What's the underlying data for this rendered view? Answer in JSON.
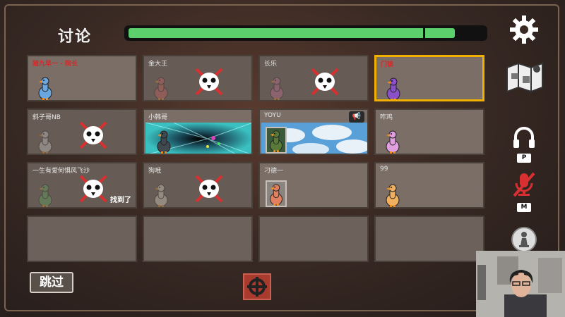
{
  "meeting": {
    "title": "讨论",
    "timer_progress": 0.92,
    "timer_marker": 0.83
  },
  "colors": {
    "timer": "#5bd06d",
    "selected": "#f0b000",
    "dead_cross": "#d83030",
    "accent_red": "#d42a2a"
  },
  "players": [
    {
      "name": "猪九早一 - 院长",
      "name_color": "red",
      "state": "alive",
      "goose_color": "#6aa6e0"
    },
    {
      "name": "金大王",
      "state": "dead",
      "goose_color": "#e06060"
    },
    {
      "name": "长乐",
      "state": "dead",
      "goose_color": "#d070a0"
    },
    {
      "name": "门锁",
      "name_color": "red",
      "state": "alive",
      "goose_color": "#8a50c8",
      "selected": true
    },
    {
      "name": "斜子哥NB",
      "state": "dead",
      "goose_color": "#d8d8d8"
    },
    {
      "name": "小韩哥",
      "state": "video",
      "goose_color": "#404850"
    },
    {
      "name": "YOYU",
      "state": "video2",
      "goose_color": "#5a7a3a"
    },
    {
      "name": "咋鸡",
      "state": "alive",
      "goose_color": "#e0a0e0"
    },
    {
      "name": "一生有爱何惧风飞沙",
      "state": "dead",
      "goose_color": "#60b060",
      "found_label": "找到了"
    },
    {
      "name": "狗哦",
      "state": "dead",
      "goose_color": "#e8e0d0"
    },
    {
      "name": "刁德一",
      "state": "alive_portrait",
      "goose_color": "#e08060"
    },
    {
      "name": "99",
      "state": "alive",
      "goose_color": "#f0b060"
    }
  ],
  "empty_slots": 4,
  "actions": {
    "skip_label": "跳过"
  },
  "sidebar": {
    "voice_key": "P",
    "mic_key": "M"
  },
  "icons": {
    "settings": "gear-icon",
    "map": "map-icon",
    "headphones": "headphones-icon",
    "mic_muted": "mic-muted-icon",
    "role": "pawn-icon",
    "skip_vote": "skip-vote-icon",
    "megaphone": "megaphone-icon"
  }
}
